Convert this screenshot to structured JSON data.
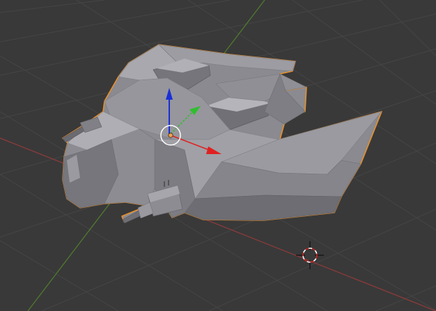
{
  "app": "3D Viewport",
  "viewport": {
    "background_color": "#393939",
    "grid_color": "#4a4a4a",
    "x_axis_color": "#8b3a3a",
    "y_axis_color": "#4f7a2e"
  },
  "selected_object": {
    "kind": "spaceship-mesh",
    "outline_color": "#e8902a",
    "surface_color": "#8e8e95"
  },
  "transform_gizmo": {
    "x_arrow_color": "#e02020",
    "y_arrow_color": "#2fbf2f",
    "z_arrow_color": "#1a2fd8",
    "origin_color": "#f0a050"
  },
  "cursor_3d": {
    "icon": "3d-cursor-icon",
    "ring_colors": [
      "#cc2222",
      "#ffffff"
    ]
  }
}
